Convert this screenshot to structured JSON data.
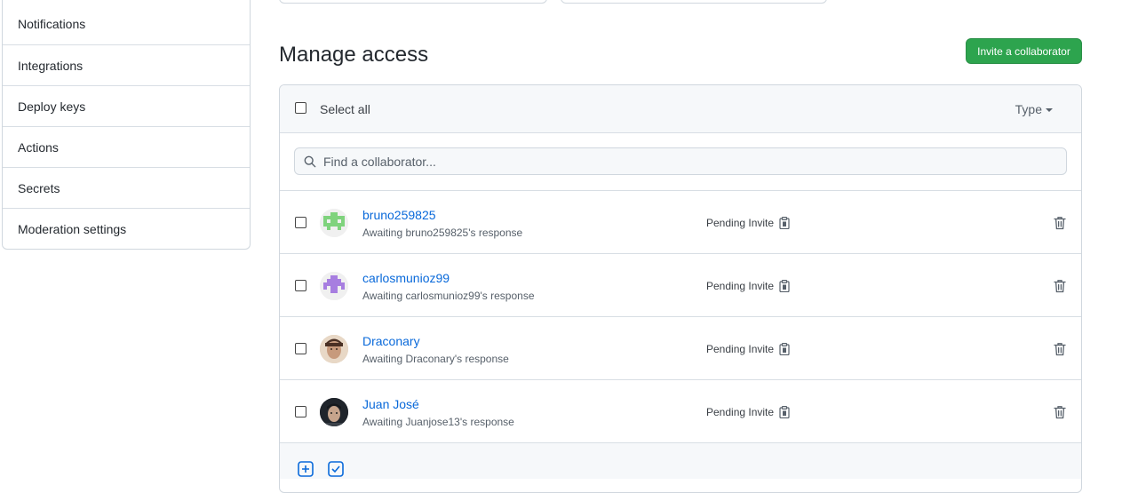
{
  "sidebar": {
    "items": [
      {
        "label": "Notifications"
      },
      {
        "label": "Integrations"
      },
      {
        "label": "Deploy keys"
      },
      {
        "label": "Actions"
      },
      {
        "label": "Secrets"
      },
      {
        "label": "Moderation settings"
      }
    ]
  },
  "header": {
    "title": "Manage access",
    "invite_label": "Invite a collaborator"
  },
  "box": {
    "select_all_label": "Select all",
    "type_filter_label": "Type",
    "search_placeholder": "Find a collaborator..."
  },
  "collaborators": [
    {
      "name": "bruno259825",
      "status": "Awaiting bruno259825's response",
      "invite": "Pending Invite",
      "avatar": "green-identicon"
    },
    {
      "name": "carlosmunioz99",
      "status": "Awaiting carlosmunioz99's response",
      "invite": "Pending Invite",
      "avatar": "purple-identicon"
    },
    {
      "name": "Draconary",
      "status": "Awaiting Draconary's response",
      "invite": "Pending Invite",
      "avatar": "photo"
    },
    {
      "name": "Juan José",
      "status": "Awaiting Juanjose13's response",
      "invite": "Pending Invite",
      "avatar": "photo"
    }
  ],
  "icons": {
    "search": "search-icon",
    "clipboard": "clipboard-icon",
    "trash": "trash-icon",
    "caret": "caret-down-icon"
  },
  "colors": {
    "accent_green": "#2da44e",
    "link_blue": "#0969da"
  }
}
